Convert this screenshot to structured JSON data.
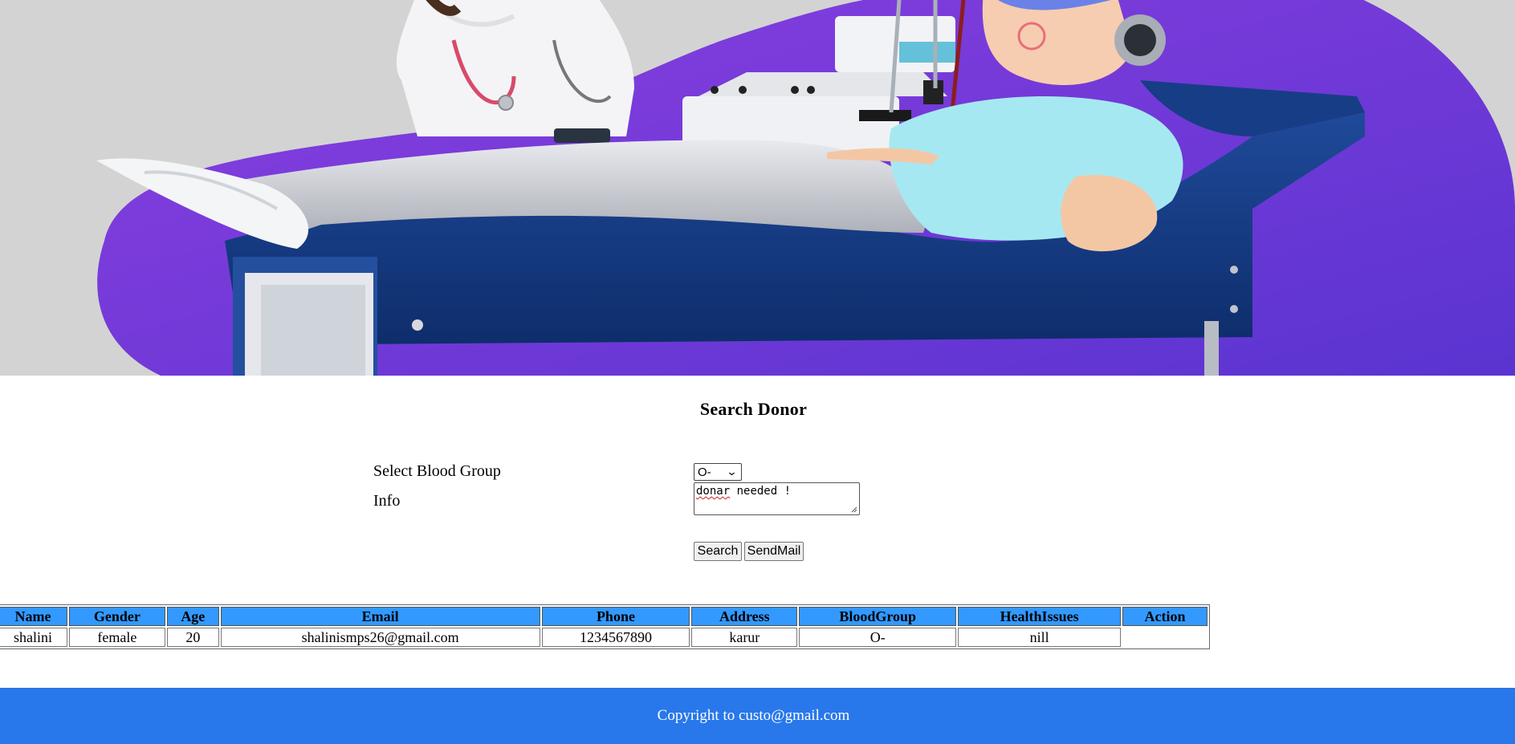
{
  "colors": {
    "hero_bg": "#d3d3d3",
    "blob": "#6a34d8",
    "header_cells": "#3399ff",
    "footer": "#2878eb"
  },
  "page_title": "Search Donor",
  "form": {
    "blood_group_label": "Select Blood Group",
    "blood_group_value": "O-",
    "info_label": "Info",
    "info_value_misspelled": "donar",
    "info_value_rest": " needed !",
    "search_label": "Search",
    "sendmail_label": "SendMail"
  },
  "table": {
    "headers": [
      "Name",
      "Gender",
      "Age",
      "Email",
      "Phone",
      "Address",
      "BloodGroup",
      "HealthIssues",
      "Action"
    ],
    "rows": [
      [
        "shalini",
        "female",
        "20",
        "shalinismps26@gmail.com",
        "1234567890",
        "karur",
        "O-",
        "nill",
        ""
      ]
    ]
  },
  "footer_text": "Copyright to custo@gmail.com"
}
